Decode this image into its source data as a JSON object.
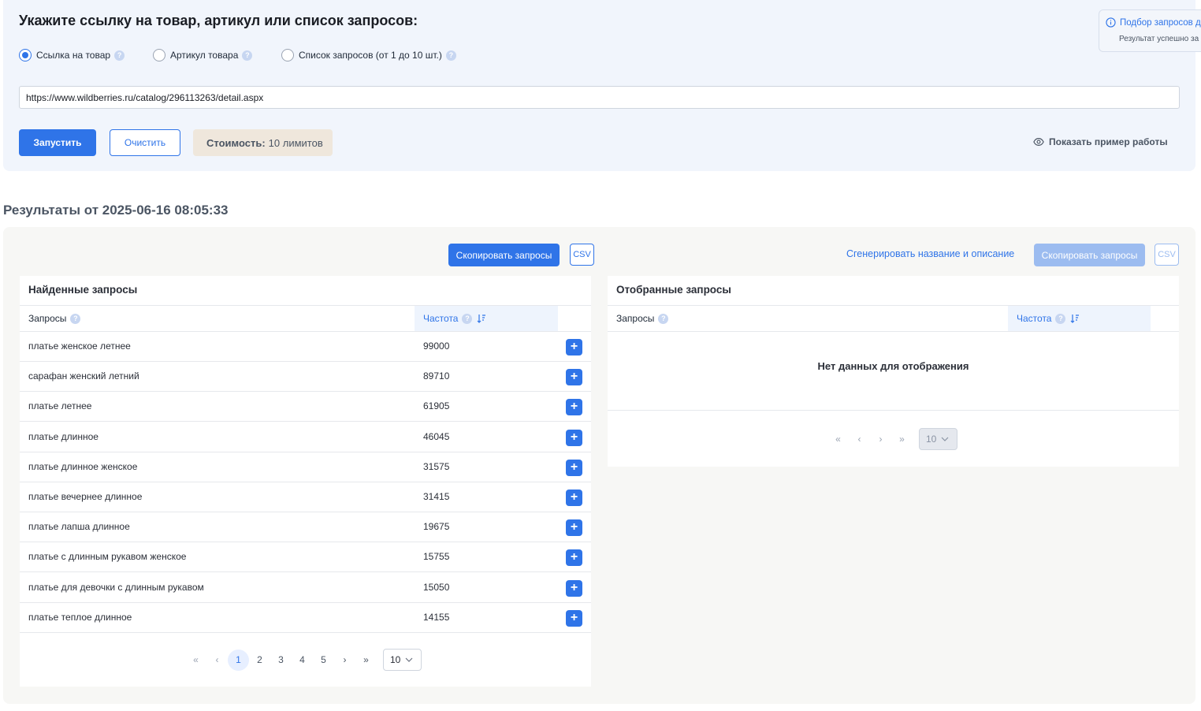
{
  "form": {
    "title": "Укажите ссылку на товар, артикул или список запросов:",
    "radios": [
      {
        "label": "Ссылка на товар",
        "checked": true
      },
      {
        "label": "Артикул товара",
        "checked": false
      },
      {
        "label": "Список запросов (от 1 до 10 шт.)",
        "checked": false
      }
    ],
    "url_value": "https://www.wildberries.ru/catalog/296113263/detail.aspx",
    "run_label": "Запустить",
    "clear_label": "Очистить",
    "cost_label": "Стоимость:",
    "cost_value": "10 лимитов",
    "show_example": "Показать пример работы"
  },
  "toast": {
    "title": "Подбор запросов д",
    "message": "Результат успешно за"
  },
  "results": {
    "title": "Результаты от 2025-06-16 08:05:33",
    "copy_label": "Скопировать запросы",
    "csv_label": "CSV",
    "generate_label": "Сгенерировать название и описание",
    "copy_label_right": "Скопировать запросы",
    "csv_label_right": "CSV"
  },
  "found": {
    "title": "Найденные запросы",
    "col_query": "Запросы",
    "col_freq": "Частота",
    "rows": [
      {
        "query": "платье женское летнее",
        "freq": "99000"
      },
      {
        "query": "сарафан женский летний",
        "freq": "89710"
      },
      {
        "query": "платье летнее",
        "freq": "61905"
      },
      {
        "query": "платье длинное",
        "freq": "46045"
      },
      {
        "query": "платье длинное женское",
        "freq": "31575"
      },
      {
        "query": "платье вечернее длинное",
        "freq": "31415"
      },
      {
        "query": "платье лапша длинное",
        "freq": "19675"
      },
      {
        "query": "платье с длинным рукавом женское",
        "freq": "15755"
      },
      {
        "query": "платье для девочки с длинным рукавом",
        "freq": "15050"
      },
      {
        "query": "платье теплое длинное",
        "freq": "14155"
      }
    ],
    "pager": {
      "first": "«",
      "prev": "‹",
      "pages": [
        "1",
        "2",
        "3",
        "4",
        "5"
      ],
      "current": "1",
      "next": "›",
      "last": "»",
      "per_page": "10"
    }
  },
  "selected": {
    "title": "Отобранные запросы",
    "col_query": "Запросы",
    "col_freq": "Частота",
    "empty_text": "Нет данных для отображения",
    "pager": {
      "first": "«",
      "prev": "‹",
      "next": "›",
      "last": "»",
      "per_page": "10"
    }
  },
  "icons": {
    "help": "question-icon",
    "eye": "eye-icon",
    "info": "info-icon",
    "sort": "sort-desc-icon",
    "add": "plus-icon",
    "chevron": "chevron-down-icon"
  },
  "colors": {
    "accent": "#2f74e8",
    "panel_bg": "#f1f5fc",
    "results_bg": "#f7f7f5",
    "cost_bg": "#efe7dc"
  }
}
